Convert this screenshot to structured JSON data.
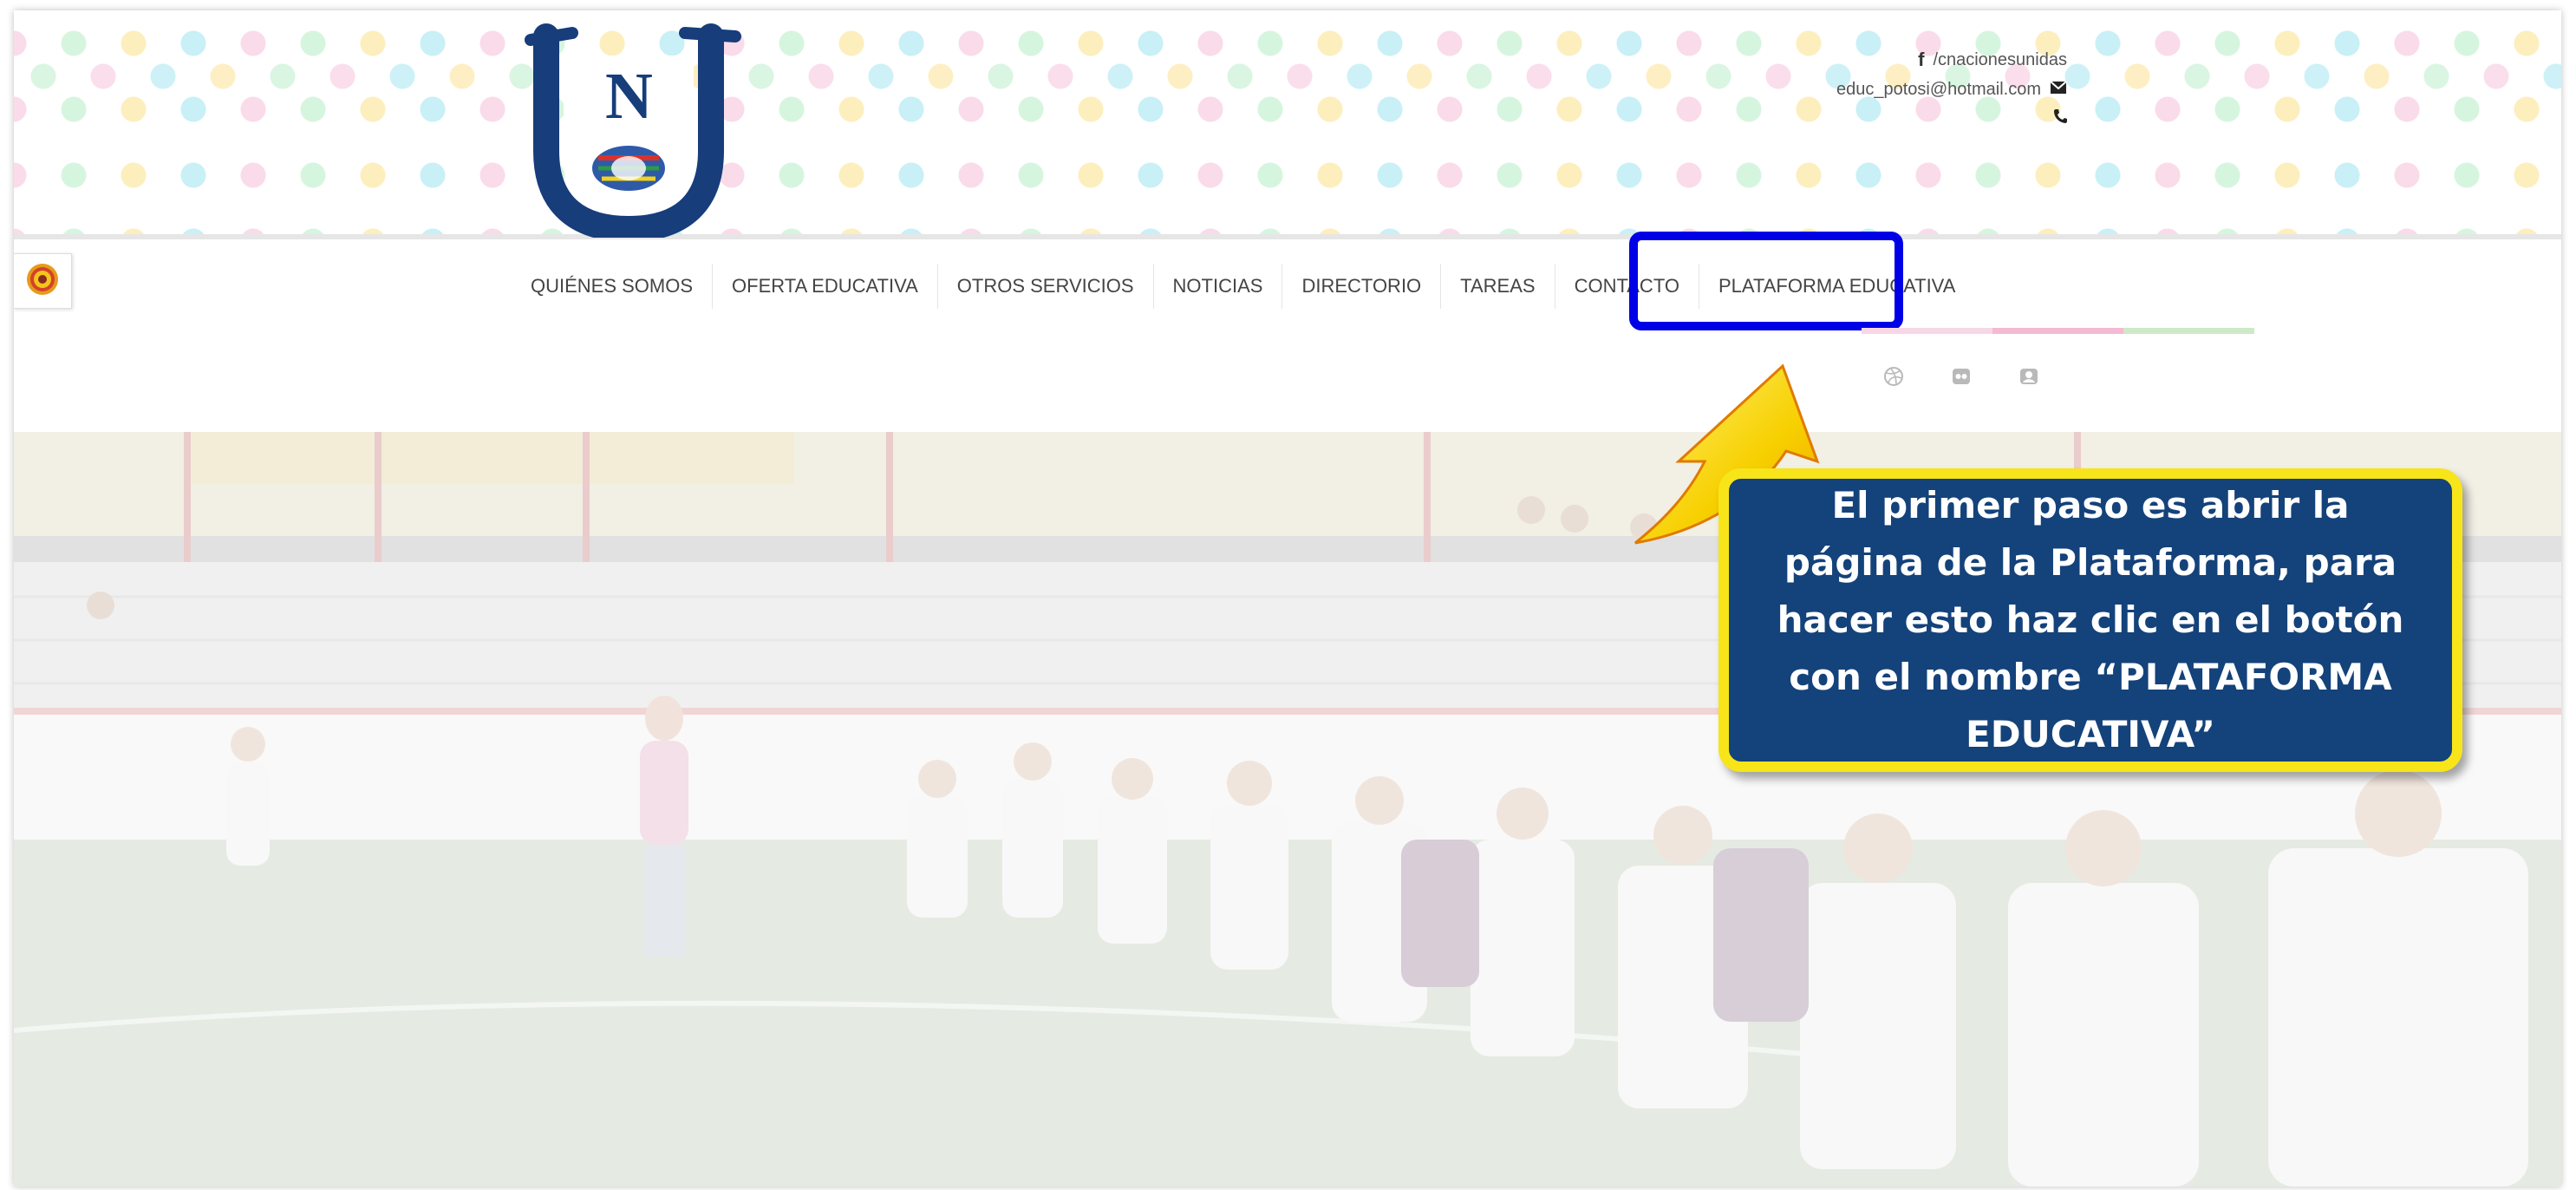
{
  "header": {
    "logo_letter": "N",
    "contact": {
      "facebook": "/cnacionesunidas",
      "email": "educ_potosi@hotmail.com"
    }
  },
  "nav": {
    "items": [
      {
        "label": "QUIÉNES SOMOS"
      },
      {
        "label": "OFERTA EDUCATIVA"
      },
      {
        "label": "OTROS SERVICIOS"
      },
      {
        "label": "NOTICIAS"
      },
      {
        "label": "DIRECTORIO"
      },
      {
        "label": "TAREAS"
      },
      {
        "label": "CONTACTO"
      },
      {
        "label": "PLATAFORMA EDUCATIVA"
      }
    ],
    "color_bars": [
      "#f7d7e6",
      "#f4b9d3",
      "#cde9c7"
    ],
    "social_icons": [
      "dribbble-icon",
      "flickr-icon",
      "user-circle-icon"
    ]
  },
  "callout": {
    "text": "El primer paso es abrir la página de la Plataforma, para hacer esto haz clic en el botón con el nombre “PLATAFORMA EDUCATIVA”"
  },
  "colors": {
    "highlight": "#0000e6",
    "callout_bg": "#14427a",
    "callout_border": "#f7e51a",
    "logo_blue": "#173d7a"
  }
}
